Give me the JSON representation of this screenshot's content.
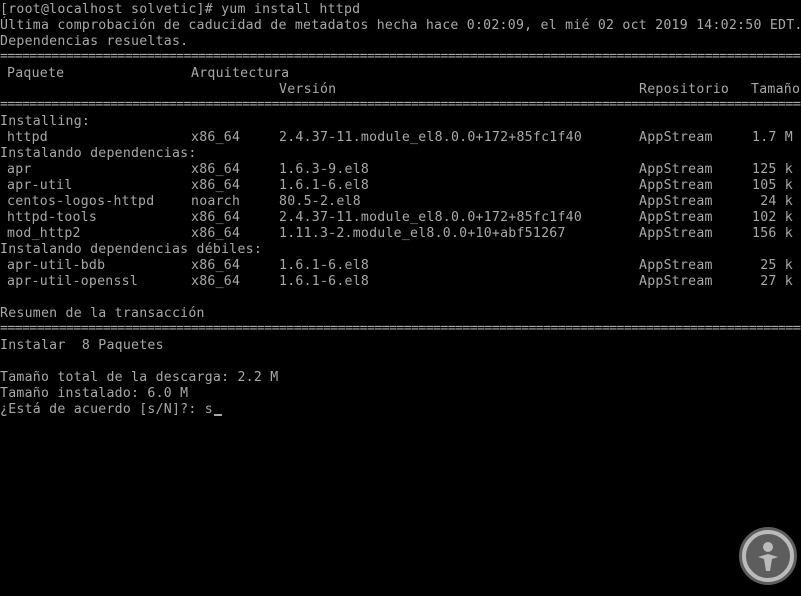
{
  "terminal": {
    "lines": [
      "[root@localhost solvetic]# yum install httpd",
      "Última comprobación de caducidad de metadatos hecha hace 0:02:09, el mié 02 oct 2019 14:02:50 EDT.",
      "Dependencias resueltas."
    ],
    "rule": "=====================================================================================================================================",
    "table_header": {
      "package": "Paquete",
      "arch": "Arquitectura",
      "version": "Versión",
      "repo": "Repositorio",
      "size": "Tamaño"
    },
    "sections": [
      {
        "title": "Installing:",
        "rows": [
          {
            "name": "httpd",
            "arch": "x86_64",
            "version": "2.4.37-11.module_el8.0.0+172+85fc1f40",
            "repo": "AppStream",
            "size": "1.7 M"
          }
        ]
      },
      {
        "title": "Instalando dependencias:",
        "rows": [
          {
            "name": "apr",
            "arch": "x86_64",
            "version": "1.6.3-9.el8",
            "repo": "AppStream",
            "size": "125 k"
          },
          {
            "name": "apr-util",
            "arch": "x86_64",
            "version": "1.6.1-6.el8",
            "repo": "AppStream",
            "size": "105 k"
          },
          {
            "name": "centos-logos-httpd",
            "arch": "noarch",
            "version": "80.5-2.el8",
            "repo": "AppStream",
            "size": "24 k"
          },
          {
            "name": "httpd-tools",
            "arch": "x86_64",
            "version": "2.4.37-11.module_el8.0.0+172+85fc1f40",
            "repo": "AppStream",
            "size": "102 k"
          },
          {
            "name": "mod_http2",
            "arch": "x86_64",
            "version": "1.11.3-2.module_el8.0.0+10+abf51267",
            "repo": "AppStream",
            "size": "156 k"
          }
        ]
      },
      {
        "title": "Instalando dependencias débiles:",
        "rows": [
          {
            "name": "apr-util-bdb",
            "arch": "x86_64",
            "version": "1.6.1-6.el8",
            "repo": "AppStream",
            "size": "25 k"
          },
          {
            "name": "apr-util-openssl",
            "arch": "x86_64",
            "version": "1.6.1-6.el8",
            "repo": "AppStream",
            "size": "27 k"
          }
        ]
      }
    ],
    "summary_title": "Resumen de la transacción",
    "install_line": "Instalar  8 Paquetes",
    "download_size": "Tamaño total de la descarga: 2.2 M",
    "installed_size": "Tamaño instalado: 6.0 M",
    "prompt": "¿Está de acuerdo [s/N]?: ",
    "input_value": "s"
  },
  "colors": {
    "background": "#000000",
    "text": "#a8a8a8",
    "watermark": "#6e6e6e"
  },
  "watermark_icon": "person-in-circle-icon"
}
